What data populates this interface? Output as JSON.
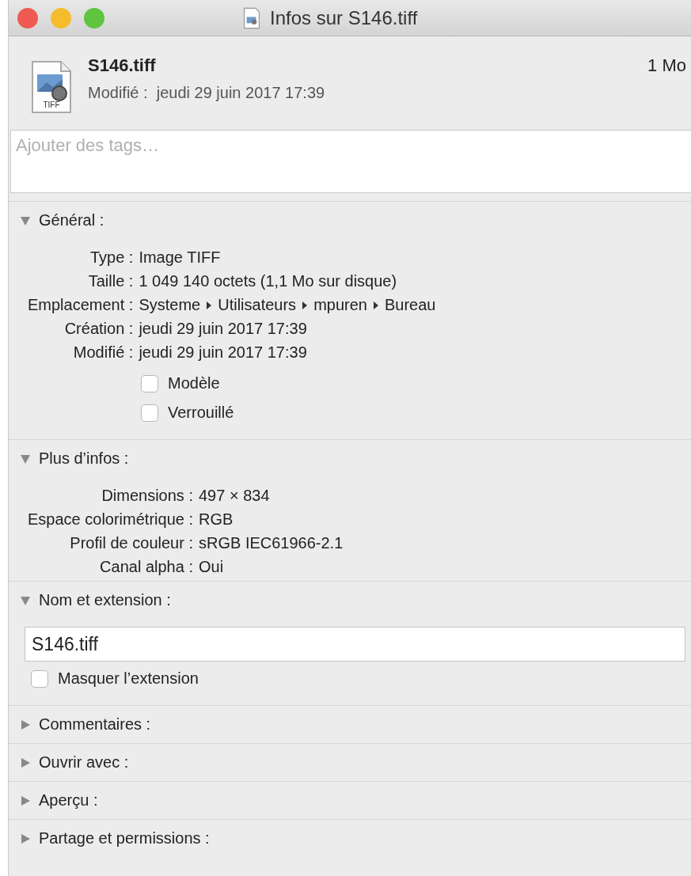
{
  "window": {
    "title": "Infos sur S146.tiff"
  },
  "header": {
    "name": "S146.tiff",
    "icon_label": "TIFF",
    "size": "1 Mo",
    "modified_label": "Modifié :",
    "modified_value": "jeudi 29 juin 2017 17:39"
  },
  "tags_field": {
    "placeholder": "Ajouter des tags…"
  },
  "sections": [
    {
      "title": "Général :",
      "expanded": true,
      "properties": [
        {
          "kind": "text",
          "label": "Type :",
          "value": "Image TIFF"
        },
        {
          "kind": "text",
          "label": "Taille :",
          "value": "1 049 140 octets (1,1 Mo sur disque)"
        },
        {
          "kind": "path",
          "label": "Emplacement :",
          "path": [
            "Systeme",
            "Utilisateurs",
            "mpuren",
            "Bureau"
          ]
        },
        {
          "kind": "text",
          "label": "Création :",
          "value": "jeudi 29 juin 2017 17:39"
        },
        {
          "kind": "text",
          "label": "Modifié :",
          "value": "jeudi 29 juin 2017 17:39"
        }
      ],
      "checkboxes": [
        {
          "label": "Modèle",
          "checked": false
        },
        {
          "label": "Verrouillé",
          "checked": false
        }
      ]
    },
    {
      "title": "Plus d’infos :",
      "expanded": true,
      "properties": [
        {
          "kind": "text",
          "label": "Dimensions :",
          "value": "497 × 834"
        },
        {
          "kind": "text",
          "label": "Espace colorimétrique :",
          "value": "RGB"
        },
        {
          "kind": "text",
          "label": "Profil de couleur :",
          "value": "sRGB IEC61966-2.1"
        },
        {
          "kind": "text",
          "label": "Canal alpha :",
          "value": "Oui"
        }
      ]
    },
    {
      "title": "Nom et extension :",
      "expanded": true,
      "name_field": {
        "value": "S146.tiff"
      },
      "checkboxes": [
        {
          "label": "Masquer l’extension",
          "checked": false
        }
      ]
    },
    {
      "title": "Commentaires :",
      "expanded": false
    },
    {
      "title": "Ouvrir avec :",
      "expanded": false
    },
    {
      "title": "Aperçu :",
      "expanded": false
    },
    {
      "title": "Partage et permissions :",
      "expanded": false
    }
  ]
}
